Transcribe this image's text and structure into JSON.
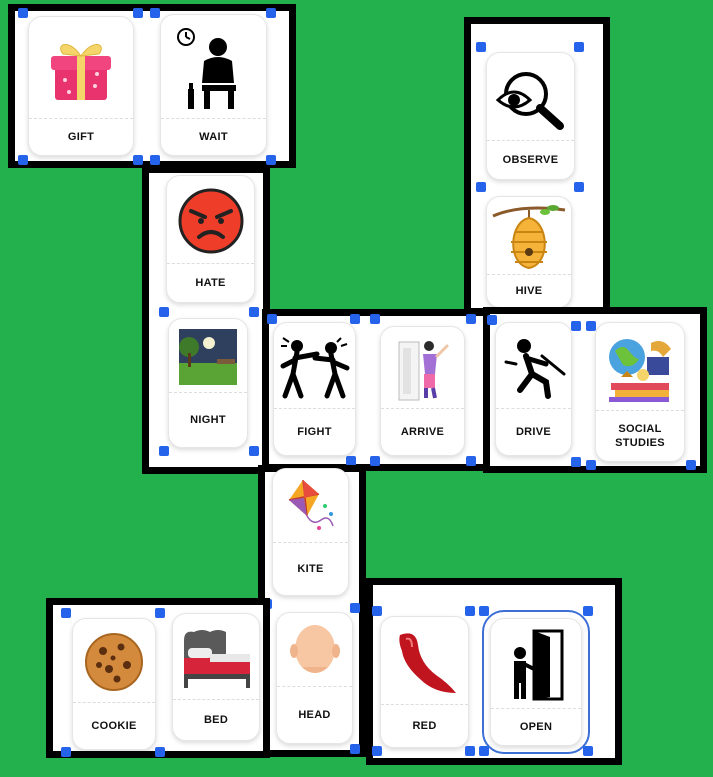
{
  "cards": {
    "gift": {
      "label": "GIFT",
      "icon": "gift-box-icon"
    },
    "wait": {
      "label": "WAIT",
      "icon": "person-waiting-clock-icon"
    },
    "observe": {
      "label": "OBSERVE",
      "icon": "eye-magnifier-icon"
    },
    "hive": {
      "label": "HIVE",
      "icon": "beehive-icon"
    },
    "hate": {
      "label": "HATE",
      "icon": "angry-face-icon"
    },
    "night": {
      "label": "NIGHT",
      "icon": "night-park-icon"
    },
    "fight": {
      "label": "FIGHT",
      "icon": "two-people-fighting-icon"
    },
    "arrive": {
      "label": "ARRIVE",
      "icon": "person-at-door-icon"
    },
    "drive": {
      "label": "DRIVE",
      "icon": "person-driving-icon"
    },
    "social_studies": {
      "label": "SOCIAL STUDIES",
      "icon": "globe-books-icon"
    },
    "kite": {
      "label": "KITE",
      "icon": "kite-icon"
    },
    "cookie": {
      "label": "COOKIE",
      "icon": "cookie-icon"
    },
    "bed": {
      "label": "BED",
      "icon": "bed-icon"
    },
    "head": {
      "label": "HEAD",
      "icon": "bald-head-icon"
    },
    "red": {
      "label": "RED",
      "icon": "red-paint-stroke-icon"
    },
    "open": {
      "label": "OPEN",
      "icon": "person-opening-door-icon"
    }
  },
  "colors": {
    "background": "#22b14c",
    "handle": "#2563eb",
    "group_border": "#000000",
    "selection": "#3b6fd6"
  }
}
